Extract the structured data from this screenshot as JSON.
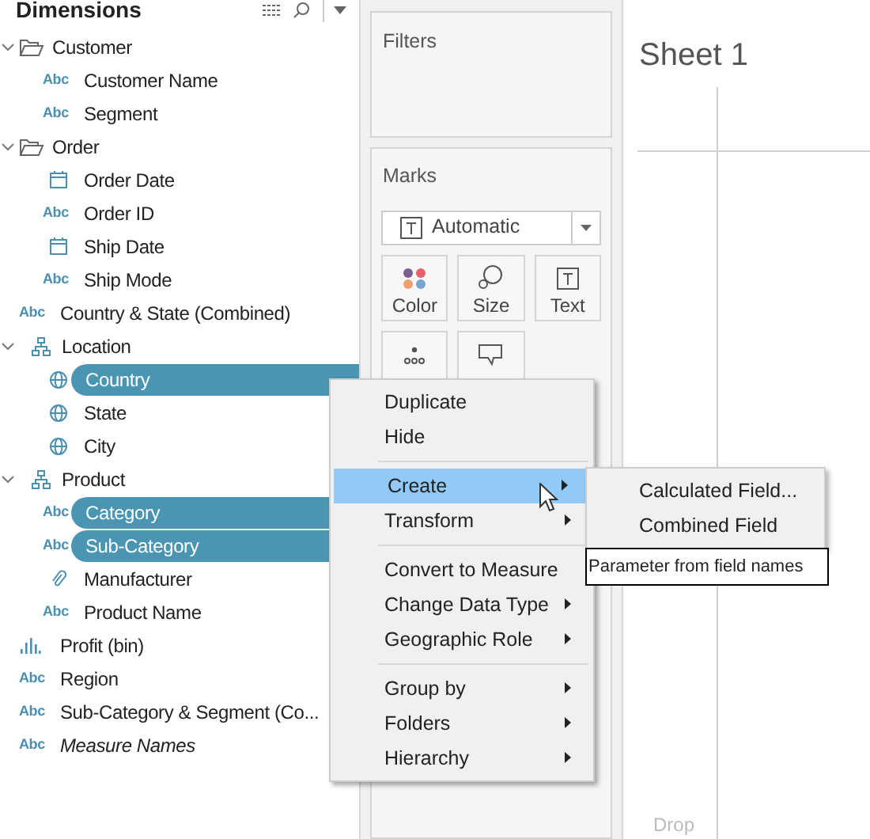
{
  "dimensions": {
    "title": "Dimensions",
    "tree": [
      {
        "kind": "folder",
        "label": "Customer",
        "expanded": true,
        "children": [
          {
            "kind": "string",
            "badge": "Abc",
            "label": "Customer Name",
            "selected": false,
            "italic": false
          },
          {
            "kind": "string",
            "badge": "Abc",
            "label": "Segment",
            "selected": false,
            "italic": false
          }
        ]
      },
      {
        "kind": "folder",
        "label": "Order",
        "expanded": true,
        "children": [
          {
            "kind": "date",
            "label": "Order Date",
            "selected": false,
            "italic": false
          },
          {
            "kind": "string",
            "badge": "Abc",
            "label": "Order ID",
            "selected": false,
            "italic": false
          },
          {
            "kind": "date",
            "label": "Ship Date",
            "selected": false,
            "italic": false
          },
          {
            "kind": "string",
            "badge": "Abc",
            "label": "Ship Mode",
            "selected": false,
            "italic": false
          }
        ]
      },
      {
        "kind": "string",
        "badge": "Abc",
        "label": "Country & State (Combined)",
        "selected": false,
        "italic": false
      },
      {
        "kind": "hierarchy",
        "label": "Location",
        "expanded": true,
        "children": [
          {
            "kind": "geo",
            "label": "Country",
            "selected": true,
            "italic": false
          },
          {
            "kind": "geo",
            "label": "State",
            "selected": false,
            "italic": false
          },
          {
            "kind": "geo",
            "label": "City",
            "selected": false,
            "italic": false
          }
        ]
      },
      {
        "kind": "hierarchy",
        "label": "Product",
        "expanded": true,
        "children": [
          {
            "kind": "string",
            "badge": "Abc",
            "label": "Category",
            "selected": true,
            "italic": false
          },
          {
            "kind": "string",
            "badge": "Abc",
            "label": "Sub-Category",
            "selected": true,
            "italic": false
          },
          {
            "kind": "group",
            "label": "Manufacturer",
            "selected": false,
            "italic": false
          },
          {
            "kind": "string",
            "badge": "Abc",
            "label": "Product Name",
            "selected": false,
            "italic": false
          }
        ]
      },
      {
        "kind": "bin",
        "label": "Profit (bin)",
        "selected": false,
        "italic": false
      },
      {
        "kind": "string",
        "badge": "Abc",
        "label": "Region",
        "selected": false,
        "italic": false
      },
      {
        "kind": "string",
        "badge": "Abc",
        "label": "Sub-Category & Segment (Co...",
        "selected": false,
        "italic": false
      },
      {
        "kind": "string",
        "badge": "Abc",
        "label": "Measure Names",
        "selected": false,
        "italic": true
      }
    ]
  },
  "filters": {
    "title": "Filters"
  },
  "marks": {
    "title": "Marks",
    "mark_type": "Automatic",
    "buttons": [
      {
        "kind": "color",
        "label": "Color"
      },
      {
        "kind": "size",
        "label": "Size"
      },
      {
        "kind": "text",
        "label": "Text"
      },
      {
        "kind": "detail"
      },
      {
        "kind": "tooltip"
      }
    ]
  },
  "sheet": {
    "title": "Sheet 1",
    "drop_hint": "Drop"
  },
  "context_menu": [
    {
      "kind": "item",
      "label": "Duplicate",
      "submenu": false,
      "selected": false
    },
    {
      "kind": "item",
      "label": "Hide",
      "submenu": false,
      "selected": false
    },
    {
      "kind": "separator"
    },
    {
      "kind": "item",
      "label": "Create",
      "submenu": true,
      "selected": true
    },
    {
      "kind": "item",
      "label": "Transform",
      "submenu": true,
      "selected": false
    },
    {
      "kind": "separator"
    },
    {
      "kind": "item",
      "label": "Convert to Measure",
      "submenu": false,
      "selected": false
    },
    {
      "kind": "item",
      "label": "Change Data Type",
      "submenu": true,
      "selected": false
    },
    {
      "kind": "item",
      "label": "Geographic Role",
      "submenu": true,
      "selected": false
    },
    {
      "kind": "separator"
    },
    {
      "kind": "item",
      "label": "Group by",
      "submenu": true,
      "selected": false
    },
    {
      "kind": "item",
      "label": "Folders",
      "submenu": true,
      "selected": false
    },
    {
      "kind": "item",
      "label": "Hierarchy",
      "submenu": true,
      "selected": false
    }
  ],
  "submenu": [
    {
      "label": "Calculated Field..."
    },
    {
      "label": "Combined Field"
    }
  ],
  "tooltip": "Parameter from field names"
}
